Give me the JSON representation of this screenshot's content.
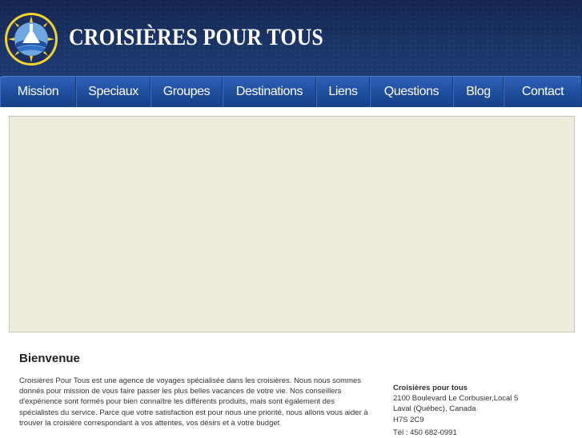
{
  "header": {
    "title": "CROISIÈRES POUR TOUS",
    "colors": {
      "background": "#1a3466",
      "logo_ring": "#f2d22e"
    }
  },
  "nav": {
    "items": [
      {
        "label": "Mission"
      },
      {
        "label": "Speciaux"
      },
      {
        "label": "Groupes"
      },
      {
        "label": "Destinations"
      },
      {
        "label": "Liens"
      },
      {
        "label": "Questions"
      },
      {
        "label": "Blog"
      },
      {
        "label": "Contact"
      }
    ],
    "color": "#1f4e9e"
  },
  "banner": {
    "color": "#efecdd"
  },
  "main": {
    "title": "Bienvenue",
    "text": "Croisières Pour Tous est une agence de voyages spécialisée dans les croisières. Nous nous sommes donnés pour mission de vous faire passer les plus belles vacances de votre vie. Nos conseillers d'expérience sont formés pour bien connaître les différents produits, mais sont également des spécialistes du service. Parce que votre satisfaction est pour nous une priorité, nous allons vous aider à trouver la croisière correspondant à vos attentes, vos désirs et à votre budget"
  },
  "contact": {
    "name": "Croisières pour tous",
    "street": "2100 Boulevard Le Corbusier,Local 5",
    "city": "Laval (Québec), Canada",
    "postal": "H7S 2C9",
    "tel": "Tél : 450 682-0991"
  }
}
